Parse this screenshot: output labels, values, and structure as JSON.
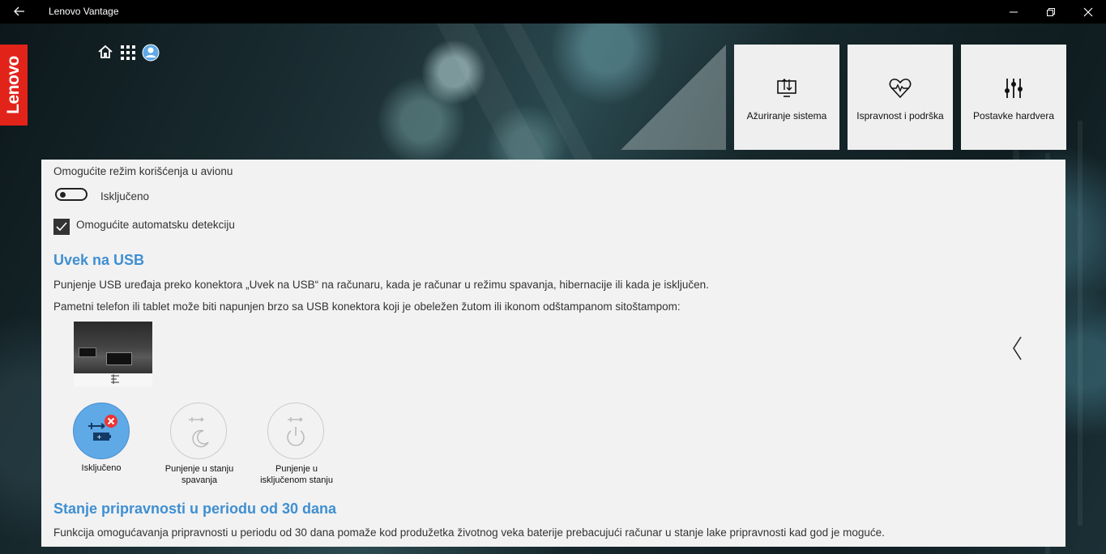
{
  "window": {
    "title": "Lenovo Vantage",
    "buttons": [
      "minimize",
      "restore",
      "close"
    ]
  },
  "brand": {
    "logo_text": "Lenovo",
    "logo_color": "#e2231a"
  },
  "nav_icons": [
    "home-icon",
    "apps-grid-icon",
    "user-icon"
  ],
  "tiles": [
    {
      "label": "Ažuriranje sistema",
      "icon": "system-update-icon"
    },
    {
      "label": "Ispravnost i podrška",
      "icon": "heartbeat-icon"
    },
    {
      "label": "Postavke hardvera",
      "icon": "sliders-icon"
    }
  ],
  "airplane": {
    "label": "Omogućite režim korišćenja u avionu",
    "toggle_state": "Isključeno",
    "auto_detect_label": "Omogućite automatsku detekciju",
    "auto_detect_checked": true
  },
  "always_on_usb": {
    "heading": "Uvek na USB",
    "desc1": "Punjenje USB uređaja preko konektora „Uvek na USB“ na računaru, kada je računar u režimu spavanja, hibernacije ili kada je isključen.",
    "desc2": "Pametni telefon ili tablet može biti napunjen brzo sa USB konektora koji je obeležen žutom ili ikonom odštampanom sitoštampom:",
    "options": [
      {
        "label": "Isključeno",
        "active": true
      },
      {
        "label": "Punjenje u stanju spavanja",
        "active": false
      },
      {
        "label": "Punjenje u isključenom stanju",
        "active": false
      }
    ],
    "accent_color": "#5ea9e6"
  },
  "standby": {
    "heading": "Stanje pripravnosti u periodu od 30 dana",
    "desc": "Funkcija omogućavanja pripravnosti u periodu od 30 dana pomaže kod produžetka životnog veka baterije prebacujući računar u stanje lake pripravnosti kad god je moguće."
  },
  "heading_color": "#3f8fd2"
}
